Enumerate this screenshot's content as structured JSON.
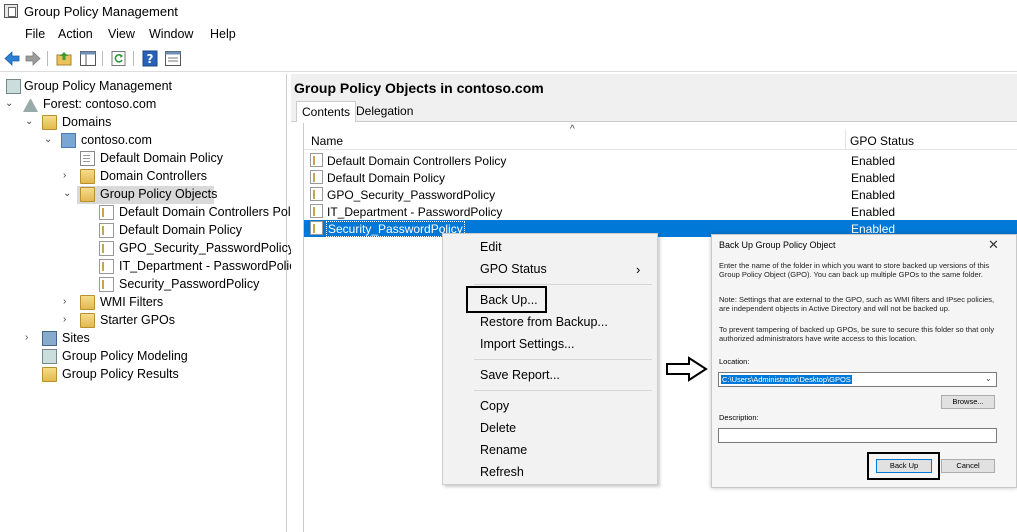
{
  "window": {
    "title": "Group Policy Management"
  },
  "menu": [
    "File",
    "Action",
    "View",
    "Window",
    "Help"
  ],
  "toolbar": {
    "icons": [
      "back-arrow-icon",
      "forward-arrow-icon",
      "up-folder-icon",
      "show-hide-tree-icon",
      "refresh-icon",
      "help-icon",
      "properties-icon"
    ]
  },
  "tree": {
    "root": "Group Policy Management",
    "forest": "Forest: contoso.com",
    "domains": "Domains",
    "domain": "contoso.com",
    "default_domain_policy": "Default Domain Policy",
    "domain_controllers": "Domain Controllers",
    "gpo_folder": "Group Policy Objects",
    "gpos": [
      "Default Domain Controllers Pol",
      "Default Domain Policy",
      "GPO_Security_PasswordPolicy",
      "IT_Department - PasswordPolicy",
      "Security_PasswordPolicy"
    ],
    "wmi_filters": "WMI Filters",
    "starter_gpos": "Starter GPOs",
    "sites": "Sites",
    "modeling": "Group Policy Modeling",
    "results": "Group Policy Results"
  },
  "content": {
    "title": "Group Policy Objects in contoso.com",
    "tabs": [
      "Contents",
      "Delegation"
    ],
    "columns": {
      "name": "Name",
      "status": "GPO Status"
    },
    "rows": [
      {
        "name": "Default Domain Controllers Policy",
        "status": "Enabled"
      },
      {
        "name": "Default Domain Policy",
        "status": "Enabled"
      },
      {
        "name": "GPO_Security_PasswordPolicy",
        "status": "Enabled"
      },
      {
        "name": "IT_Department - PasswordPolicy",
        "status": "Enabled"
      },
      {
        "name": "Security_PasswordPolicy",
        "status": "Enabled"
      }
    ]
  },
  "context_menu": {
    "edit": "Edit",
    "gpo_status": "GPO Status",
    "back_up": "Back Up...",
    "restore": "Restore from Backup...",
    "import": "Import Settings...",
    "save_report": "Save Report...",
    "copy": "Copy",
    "delete": "Delete",
    "rename": "Rename",
    "refresh": "Refresh"
  },
  "dialog": {
    "title": "Back Up Group Policy Object",
    "close": "✕",
    "text1": "Enter the name of the folder in which you want to store backed up versions of this Group Policy Object (GPO). You can back up multiple GPOs to the same folder.",
    "text2": "Note: Settings that are external to the GPO, such as WMI filters and IPsec policies, are independent objects in Active Directory and will not be backed up.",
    "text3": "To prevent tampering of backed up GPOs, be sure to secure this folder so that only authorized administrators have write access to this location.",
    "location_label": "Location:",
    "location_value": "C:\\Users\\Administrator\\Desktop\\GPOS",
    "browse": "Browse...",
    "description_label": "Description:",
    "description_value": "",
    "back_up_button": "Back Up",
    "cancel_button": "Cancel"
  },
  "colors": {
    "selection": "#0078d7",
    "tree_selection": "#d9d9d9",
    "menu_bg": "#f2f2f2"
  }
}
